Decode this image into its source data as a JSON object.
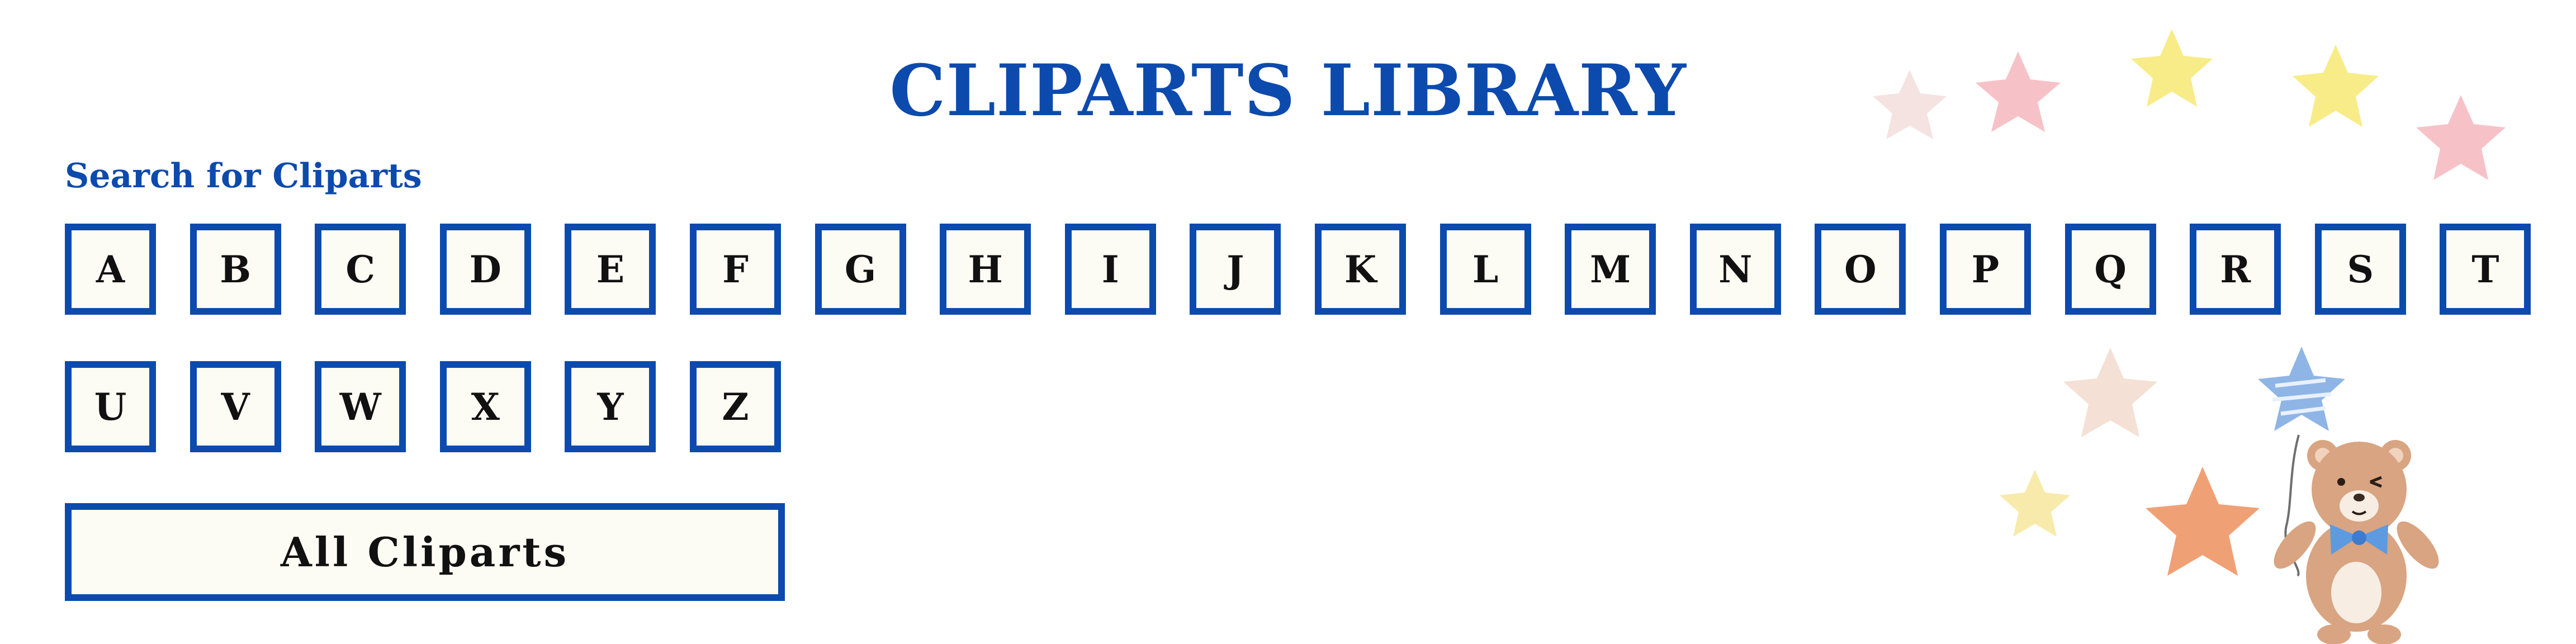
{
  "page": {
    "title": "CLIPARTS LIBRARY",
    "subtitle": "Search for Cliparts",
    "all_button_label": "All Cliparts"
  },
  "letters": [
    "A",
    "B",
    "C",
    "D",
    "E",
    "F",
    "G",
    "H",
    "I",
    "J",
    "K",
    "L",
    "M",
    "N",
    "O",
    "P",
    "Q",
    "R",
    "S",
    "T",
    "U",
    "V",
    "W",
    "X",
    "Y",
    "Z"
  ],
  "colors": {
    "brand_blue": "#0d4aad",
    "button_fill": "#fcfbf4",
    "button_text": "#111111",
    "star_pink": "#f6c2c8",
    "star_light_pink": "#f4e3e1",
    "star_yellow": "#f8ec88",
    "star_peach": "#f4e0d4",
    "star_light_yellow": "#f8eaaa",
    "star_orange": "#f0a075",
    "balloon_blue": "#8fb5e6",
    "bear_brown": "#d8a482",
    "bow_blue": "#5d9ae0"
  },
  "decorations": {
    "icons": [
      "star-icon",
      "star-balloon-icon",
      "teddy-bear-icon"
    ]
  }
}
